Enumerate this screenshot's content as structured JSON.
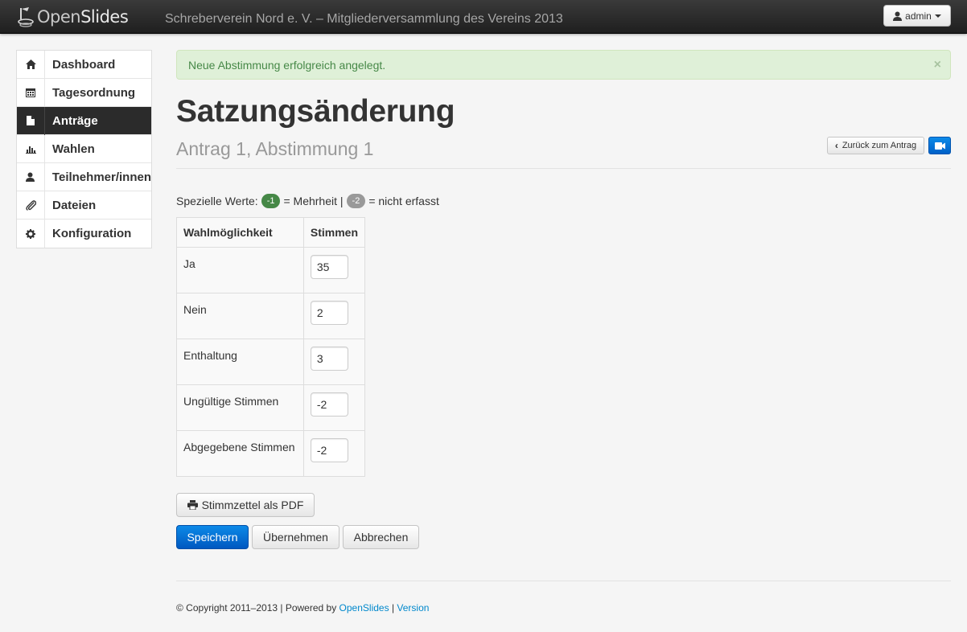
{
  "navbar": {
    "brand_prefix": "Open",
    "brand_suffix": "Slides",
    "event_title": "Schreberverein Nord e. V. – Mitgliederversammlung des Vereins 2013",
    "user_label": "admin"
  },
  "sidebar": {
    "items": [
      {
        "label": "Dashboard",
        "icon": "home-icon"
      },
      {
        "label": "Tagesordnung",
        "icon": "calendar-icon"
      },
      {
        "label": "Anträge",
        "icon": "file-icon",
        "active": true
      },
      {
        "label": "Wahlen",
        "icon": "bar-chart-icon"
      },
      {
        "label": "Teilnehmer/innen",
        "icon": "user-icon"
      },
      {
        "label": "Dateien",
        "icon": "paperclip-icon"
      },
      {
        "label": "Konfiguration",
        "icon": "gear-icon"
      }
    ]
  },
  "alert": {
    "message": "Neue Abstimmung erfolgreich angelegt.",
    "close": "×"
  },
  "page": {
    "title": "Satzungsänderung",
    "subtitle": "Antrag 1, Abstimmung 1",
    "back_button": "Zurück zum Antrag"
  },
  "special_values": {
    "prefix": "Spezielle Werte:",
    "badge1": "-1",
    "text1": "= Mehrheit |",
    "badge2": "-2",
    "text2": "= nicht erfasst"
  },
  "vote_table": {
    "headers": [
      "Wahlmöglichkeit",
      "Stimmen"
    ],
    "rows": [
      {
        "option": "Ja",
        "value": "35"
      },
      {
        "option": "Nein",
        "value": "2"
      },
      {
        "option": "Enthaltung",
        "value": "3"
      },
      {
        "option": "Ungültige Stimmen",
        "value": "-2"
      },
      {
        "option": "Abgegebene Stimmen",
        "value": "-2"
      }
    ]
  },
  "buttons": {
    "pdf": "Stimmzettel als PDF",
    "save": "Speichern",
    "apply": "Übernehmen",
    "cancel": "Abbrechen"
  },
  "footer": {
    "copyright": "© Copyright 2011–2013 | Powered by",
    "powered_link": "OpenSlides",
    "separator": "|",
    "version_link": "Version"
  },
  "colors": {
    "primary": "#0a7fe0",
    "success_text": "#468847",
    "success_bg": "#dff0d8",
    "link": "#0088cc",
    "navbar": "#2b2b2b"
  }
}
